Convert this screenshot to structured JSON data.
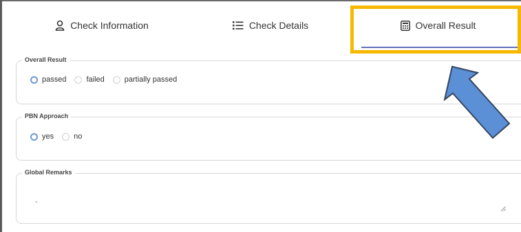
{
  "tabs": [
    {
      "label": "Check Information",
      "icon": "user-icon"
    },
    {
      "label": "Check Details",
      "icon": "list-icon"
    },
    {
      "label": "Overall Result",
      "icon": "calculator-icon"
    }
  ],
  "active_tab": 2,
  "highlight_color": "#f6b800",
  "arrow_color": "#5b8fd6",
  "sections": {
    "overall_result": {
      "legend": "Overall Result",
      "options": [
        "passed",
        "failed",
        "partially passed"
      ],
      "selected": "passed"
    },
    "pbn_approach": {
      "legend": "PBN Approach",
      "options": [
        "yes",
        "no"
      ],
      "selected": "yes"
    },
    "global_remarks": {
      "legend": "Global Remarks",
      "value": "-"
    }
  }
}
